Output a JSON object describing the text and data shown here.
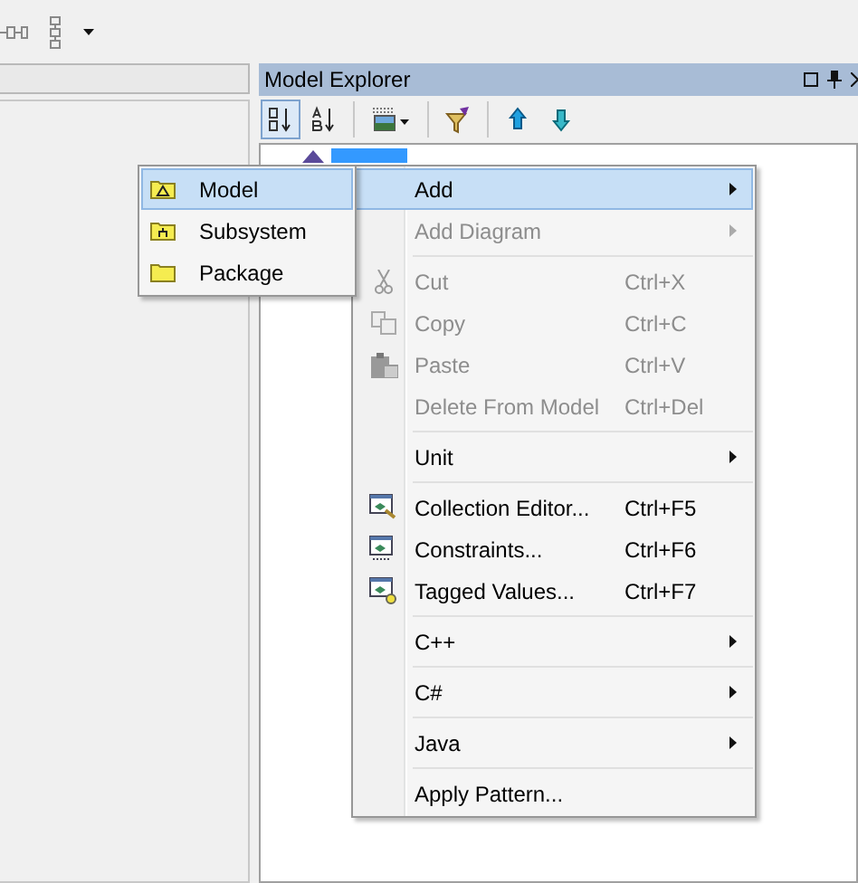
{
  "explorer": {
    "title": "Model Explorer"
  },
  "context_menu": {
    "items": [
      {
        "kind": "item",
        "label": "Add",
        "submenu": true,
        "disabled": false,
        "selected": true
      },
      {
        "kind": "item",
        "label": "Add Diagram",
        "submenu": true,
        "disabled": true,
        "selected": false
      },
      {
        "kind": "separator"
      },
      {
        "kind": "item",
        "label": "Cut",
        "shortcut": "Ctrl+X",
        "submenu": false,
        "disabled": true,
        "selected": false
      },
      {
        "kind": "item",
        "label": "Copy",
        "shortcut": "Ctrl+C",
        "submenu": false,
        "disabled": true,
        "selected": false
      },
      {
        "kind": "item",
        "label": "Paste",
        "shortcut": "Ctrl+V",
        "submenu": false,
        "disabled": true,
        "selected": false
      },
      {
        "kind": "item",
        "label": "Delete From Model",
        "shortcut": "Ctrl+Del",
        "submenu": false,
        "disabled": true,
        "selected": false
      },
      {
        "kind": "separator"
      },
      {
        "kind": "item",
        "label": "Unit",
        "submenu": true,
        "disabled": false,
        "selected": false
      },
      {
        "kind": "separator"
      },
      {
        "kind": "item",
        "label": "Collection Editor...",
        "shortcut": "Ctrl+F5",
        "submenu": false,
        "disabled": false,
        "selected": false
      },
      {
        "kind": "item",
        "label": "Constraints...",
        "shortcut": "Ctrl+F6",
        "submenu": false,
        "disabled": false,
        "selected": false
      },
      {
        "kind": "item",
        "label": "Tagged Values...",
        "shortcut": "Ctrl+F7",
        "submenu": false,
        "disabled": false,
        "selected": false
      },
      {
        "kind": "separator"
      },
      {
        "kind": "item",
        "label": "C++",
        "submenu": true,
        "disabled": false,
        "selected": false
      },
      {
        "kind": "separator"
      },
      {
        "kind": "item",
        "label": "C#",
        "submenu": true,
        "disabled": false,
        "selected": false
      },
      {
        "kind": "separator"
      },
      {
        "kind": "item",
        "label": "Java",
        "submenu": true,
        "disabled": false,
        "selected": false
      },
      {
        "kind": "separator"
      },
      {
        "kind": "item",
        "label": "Apply Pattern...",
        "submenu": false,
        "disabled": false,
        "selected": false
      }
    ]
  },
  "submenu": {
    "items": [
      {
        "label": "Model",
        "selected": true
      },
      {
        "label": "Subsystem",
        "selected": false
      },
      {
        "label": "Package",
        "selected": false
      }
    ]
  }
}
